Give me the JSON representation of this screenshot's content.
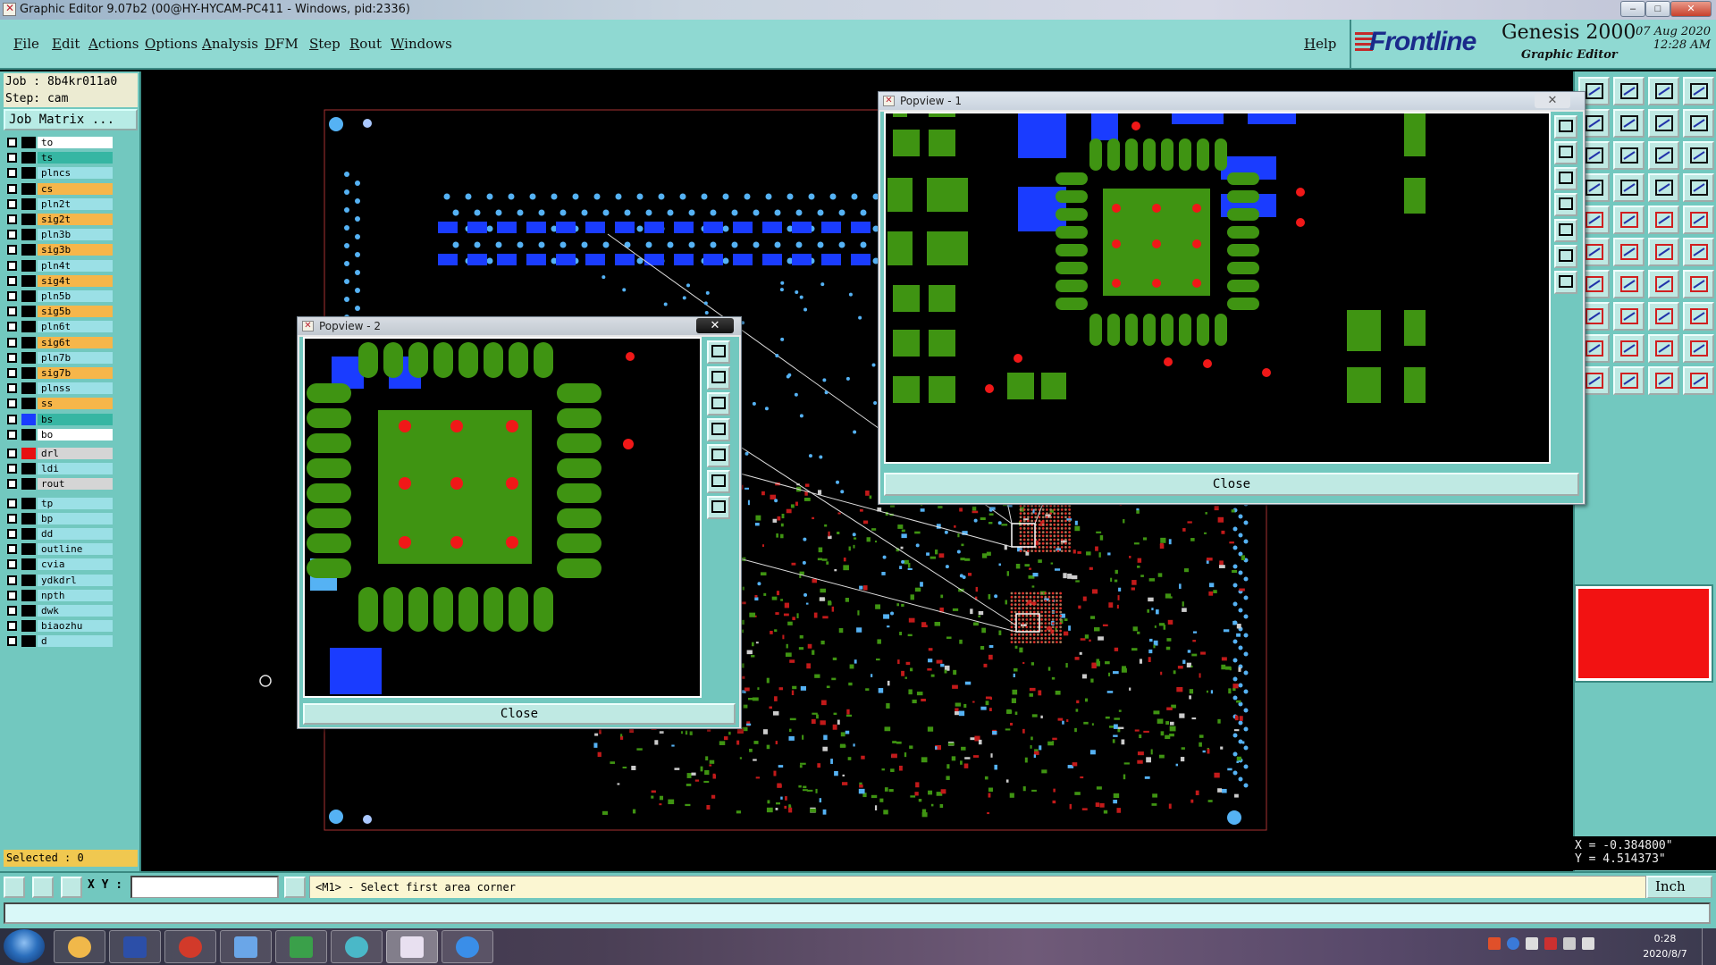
{
  "window": {
    "title": "Graphic Editor 9.07b2 (00@HY-HYCAM-PC411 - Windows, pid:2336)",
    "controls": [
      "minimize",
      "maximize",
      "close"
    ]
  },
  "menu": {
    "items": [
      "File",
      "Edit",
      "Actions",
      "Options",
      "Analysis",
      "DFM",
      "Step",
      "Rout",
      "Windows"
    ],
    "help": "Help"
  },
  "brand": {
    "logo": "Frontline",
    "product": "Genesis 2000",
    "subtitle": "Graphic Editor",
    "date": "07 Aug 2020",
    "time": "12:28 AM"
  },
  "job": {
    "job_line": "Job : 8b4kr011a0",
    "step_line": "Step: cam",
    "matrix_button": "Job Matrix ..."
  },
  "layers": [
    {
      "name": "to",
      "swatch": "#000000",
      "style": "white",
      "arrow": true
    },
    {
      "name": "ts",
      "swatch": "#000000",
      "style": "teal"
    },
    {
      "name": "plncs",
      "swatch": "#000000",
      "style": "cyan"
    },
    {
      "name": "cs",
      "swatch": "#000000",
      "style": "orange"
    },
    {
      "name": "pln2t",
      "swatch": "#000000",
      "style": "cyan"
    },
    {
      "name": "sig2t",
      "swatch": "#000000",
      "style": "orange"
    },
    {
      "name": "pln3b",
      "swatch": "#000000",
      "style": "cyan"
    },
    {
      "name": "sig3b",
      "swatch": "#000000",
      "style": "orange"
    },
    {
      "name": "pln4t",
      "swatch": "#000000",
      "style": "cyan"
    },
    {
      "name": "sig4t",
      "swatch": "#000000",
      "style": "orange"
    },
    {
      "name": "pln5b",
      "swatch": "#000000",
      "style": "cyan"
    },
    {
      "name": "sig5b",
      "swatch": "#000000",
      "style": "orange"
    },
    {
      "name": "pln6t",
      "swatch": "#000000",
      "style": "cyan"
    },
    {
      "name": "sig6t",
      "swatch": "#000000",
      "style": "orange"
    },
    {
      "name": "pln7b",
      "swatch": "#000000",
      "style": "cyan"
    },
    {
      "name": "sig7b",
      "swatch": "#000000",
      "style": "orange"
    },
    {
      "name": "plnss",
      "swatch": "#000000",
      "style": "cyan"
    },
    {
      "name": "ss",
      "swatch": "#000000",
      "style": "orange"
    },
    {
      "name": "bs",
      "swatch": "#1a3cff",
      "style": "teal"
    },
    {
      "name": "bo",
      "swatch": "#000000",
      "style": "white",
      "arrow": true
    },
    {
      "name": "drl",
      "swatch": "#e81010",
      "style": "gray",
      "arrow": true
    },
    {
      "name": "ldi",
      "swatch": "#000000",
      "style": "cyan"
    },
    {
      "name": "rout",
      "swatch": "#000000",
      "style": "gray"
    },
    {
      "name": "tp",
      "swatch": "#000000",
      "style": "cyan"
    },
    {
      "name": "bp",
      "swatch": "#000000",
      "style": "cyan"
    },
    {
      "name": "dd",
      "swatch": "#000000",
      "style": "cyan"
    },
    {
      "name": "outline",
      "swatch": "#000000",
      "style": "cyan"
    },
    {
      "name": "cvia",
      "swatch": "#000000",
      "style": "cyan"
    },
    {
      "name": "ydkdrl",
      "swatch": "#000000",
      "style": "cyan"
    },
    {
      "name": "npth",
      "swatch": "#000000",
      "style": "cyan"
    },
    {
      "name": "dwk",
      "swatch": "#000000",
      "style": "cyan"
    },
    {
      "name": "biaozhu",
      "swatch": "#000000",
      "style": "cyan"
    },
    {
      "name": "d",
      "swatch": "#000000",
      "style": "cyan"
    }
  ],
  "selected_text": "Selected : 0",
  "popview1": {
    "title": "Popview - 1",
    "close_label": "Close"
  },
  "popview2": {
    "title": "Popview - 2",
    "close_label": "Close"
  },
  "coords": {
    "x": "X = -0.384800\"",
    "y": "Y = 4.514373\""
  },
  "command": {
    "xy_label": "X Y :",
    "xy_value": "",
    "prompt": "<M1> - Select first area corner",
    "units": "Inch"
  },
  "taskbar": {
    "time": "0:28",
    "date": "2020/8/7"
  },
  "colors": {
    "pad_green": "#3f9412",
    "drill_red": "#f01818",
    "mask_blue": "#1a3cff",
    "mask_light_blue": "#55b2f4",
    "panel_teal": "#72c8bf",
    "active_color_swatch": "#f21212"
  }
}
